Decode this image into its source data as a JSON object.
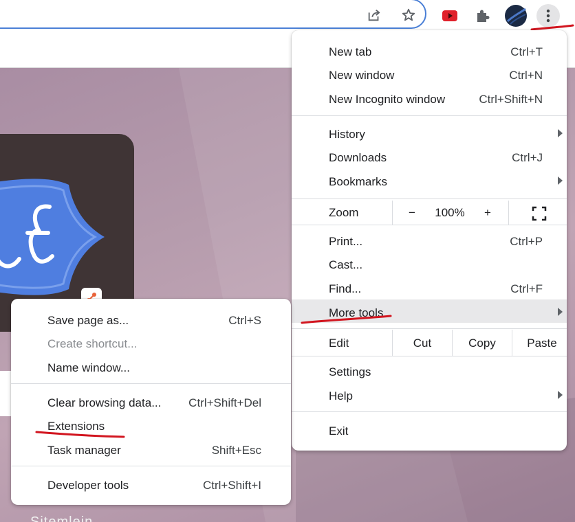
{
  "toolbar": {
    "share_icon": "share-icon",
    "bookmark_icon": "star-icon",
    "extensions": [
      "youtube-extension-icon",
      "puzzle-extensions-icon"
    ],
    "profile_icon": "profile-avatar",
    "menu_icon": "three-dots-vertical-icon"
  },
  "main_menu": {
    "new_tab": {
      "label": "New tab",
      "shortcut": "Ctrl+T"
    },
    "new_window": {
      "label": "New window",
      "shortcut": "Ctrl+N"
    },
    "new_incognito": {
      "label": "New Incognito window",
      "shortcut": "Ctrl+Shift+N"
    },
    "history": {
      "label": "History"
    },
    "downloads": {
      "label": "Downloads",
      "shortcut": "Ctrl+J"
    },
    "bookmarks": {
      "label": "Bookmarks"
    },
    "zoom": {
      "label": "Zoom",
      "minus": "−",
      "value": "100%",
      "plus": "+"
    },
    "print": {
      "label": "Print...",
      "shortcut": "Ctrl+P"
    },
    "cast": {
      "label": "Cast..."
    },
    "find": {
      "label": "Find...",
      "shortcut": "Ctrl+F"
    },
    "more_tools": {
      "label": "More tools"
    },
    "edit": {
      "label": "Edit",
      "cut": "Cut",
      "copy": "Copy",
      "paste": "Paste"
    },
    "settings": {
      "label": "Settings"
    },
    "help": {
      "label": "Help"
    },
    "exit": {
      "label": "Exit"
    }
  },
  "sub_menu": {
    "save_page": {
      "label": "Save page as...",
      "shortcut": "Ctrl+S"
    },
    "create_shortcut": {
      "label": "Create shortcut..."
    },
    "name_window": {
      "label": "Name window..."
    },
    "clear_browsing": {
      "label": "Clear browsing data...",
      "shortcut": "Ctrl+Shift+Del"
    },
    "extensions": {
      "label": "Extensions"
    },
    "task_manager": {
      "label": "Task manager",
      "shortcut": "Shift+Esc"
    },
    "developer_tools": {
      "label": "Developer tools",
      "shortcut": "Ctrl+Shift+I"
    }
  },
  "background": {
    "bottom_text": "Sitemlein"
  },
  "colors": {
    "omnibox_border": "#4a7fd6",
    "annotation_red": "#d2151f",
    "youtube_red": "#e0202a",
    "logo_blue": "#4f7ee0",
    "tile_dark": "#3f3435"
  }
}
